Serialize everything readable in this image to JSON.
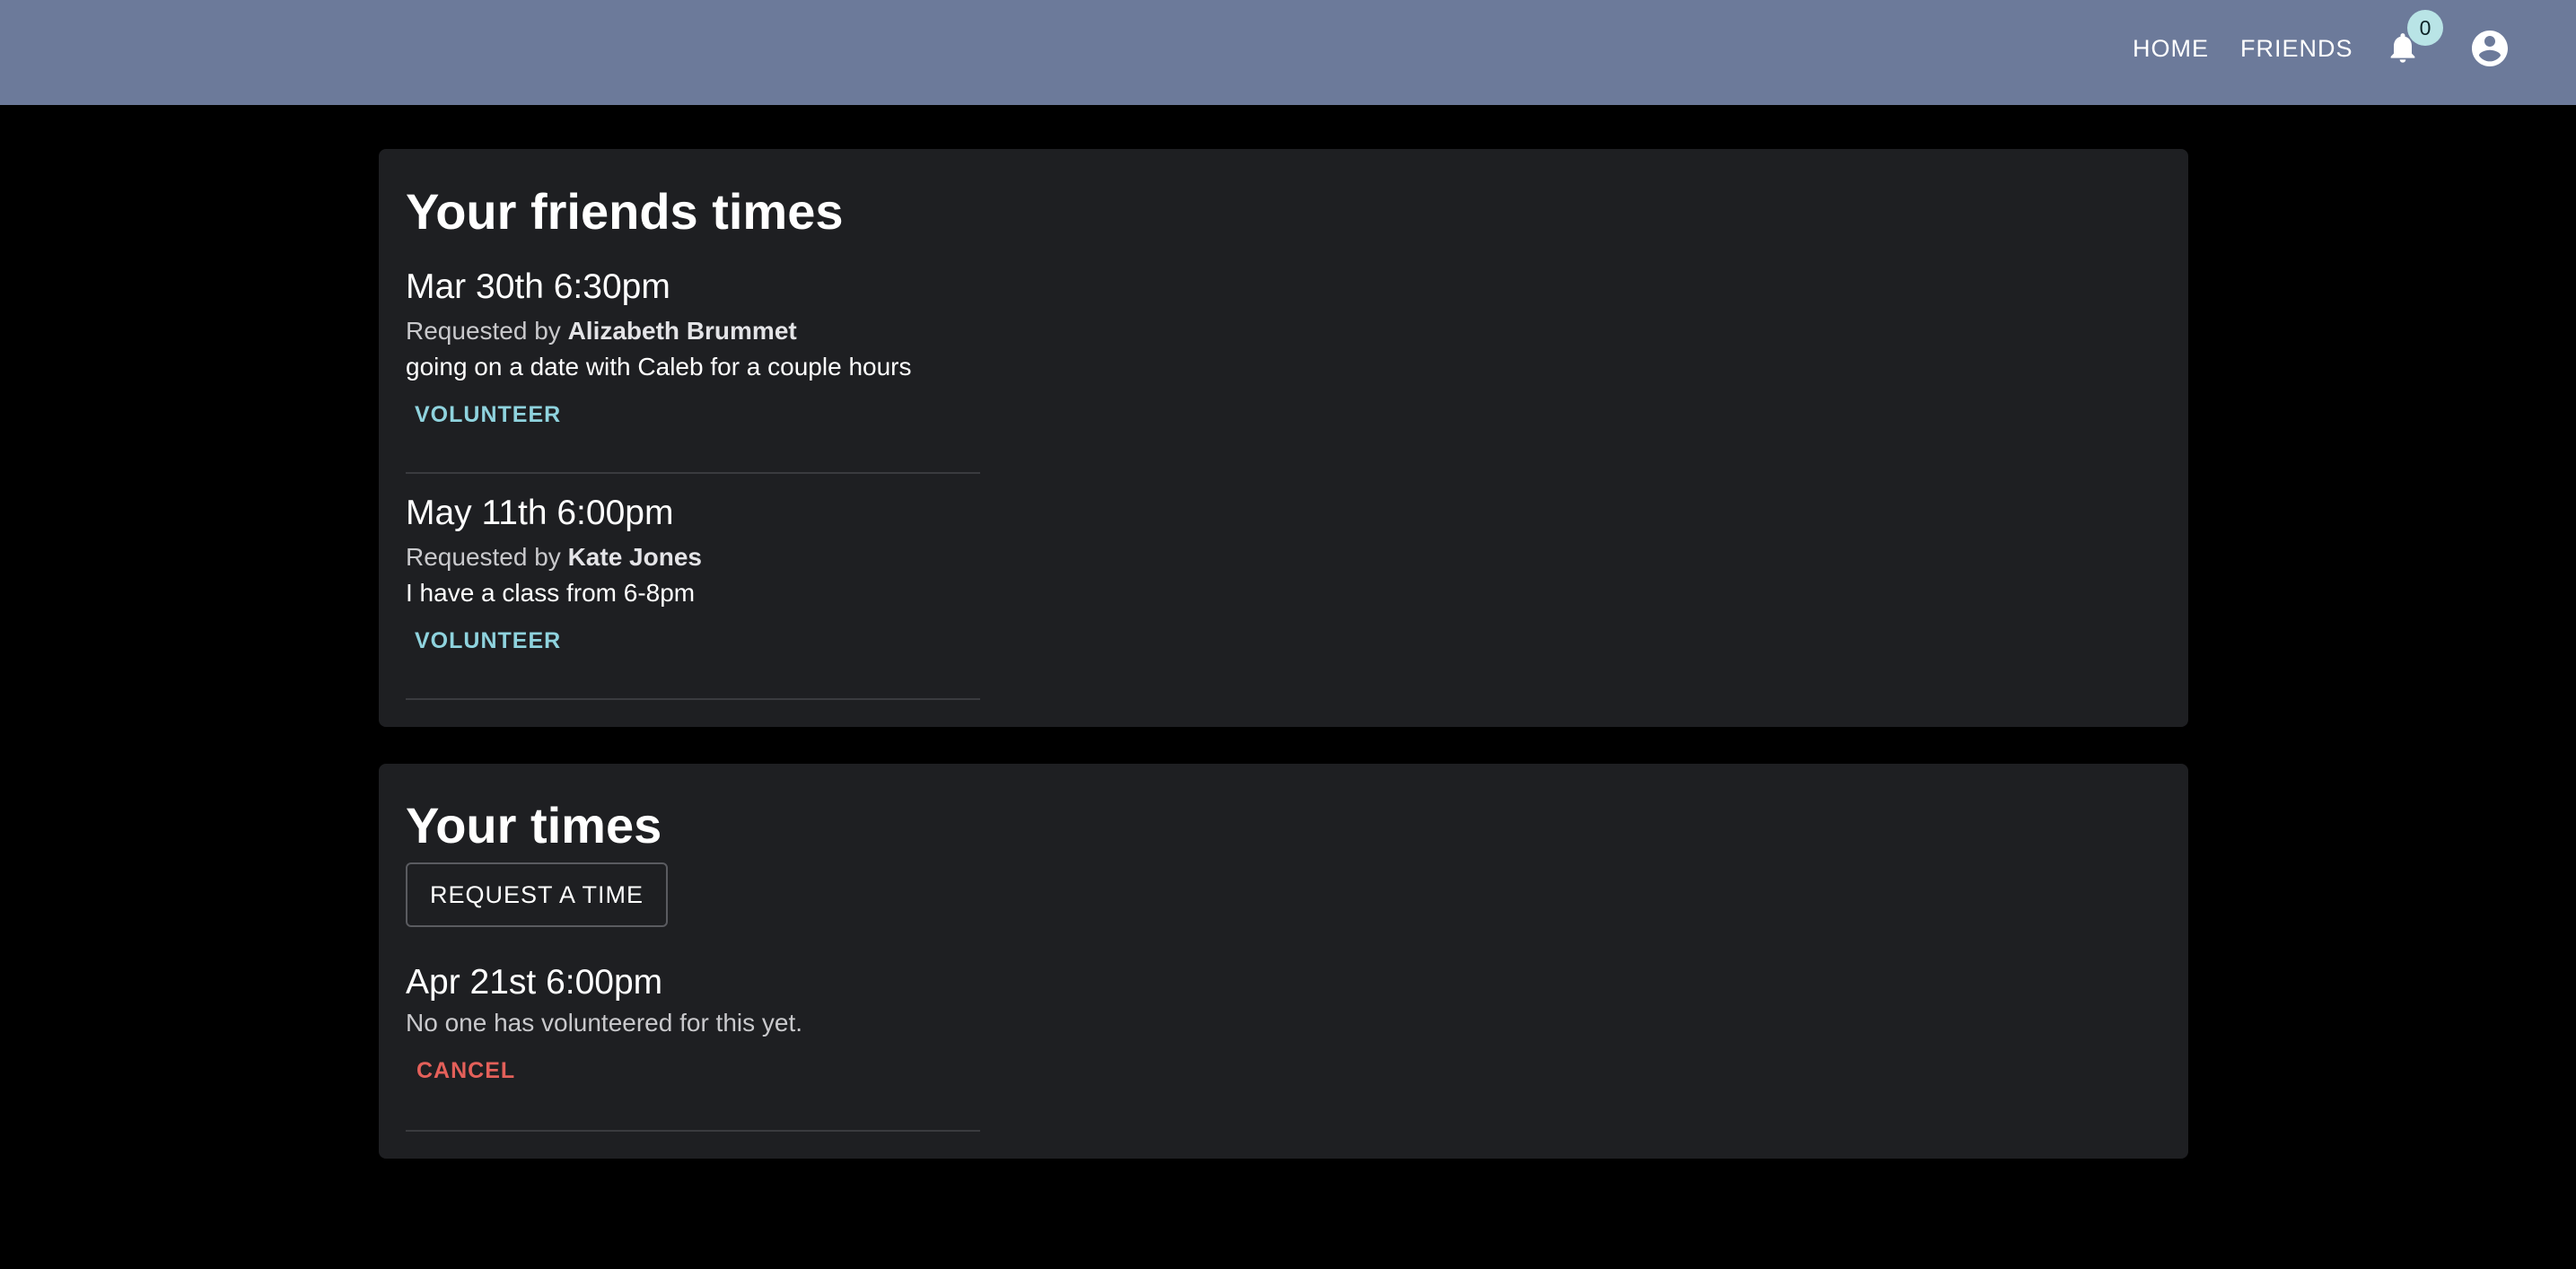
{
  "nav": {
    "home_label": "HOME",
    "friends_label": "FRIENDS",
    "notification_count": "0",
    "bell_icon": "bell-icon",
    "account_icon": "account-circle-icon"
  },
  "friends_section": {
    "title": "Your friends times",
    "requested_by_prefix": "Requested by",
    "items": [
      {
        "date": "Mar 30th 6:30pm",
        "requester": "Alizabeth Brummet",
        "note": "going on a date with Caleb for a couple hours",
        "action_label": "VOLUNTEER"
      },
      {
        "date": "May 11th 6:00pm",
        "requester": "Kate Jones",
        "note": "I have a class from 6-8pm",
        "action_label": "VOLUNTEER"
      }
    ]
  },
  "my_section": {
    "title": "Your times",
    "request_button_label": "REQUEST A TIME",
    "items": [
      {
        "date": "Apr 21st 6:00pm",
        "status": "No one has volunteered for this yet.",
        "action_label": "CANCEL"
      }
    ]
  },
  "colors": {
    "appbar": "#6c7a9a",
    "card": "#1e1f22",
    "volunteer": "#8fd3de",
    "cancel": "#e4605a",
    "badge": "#b9e4e6"
  }
}
